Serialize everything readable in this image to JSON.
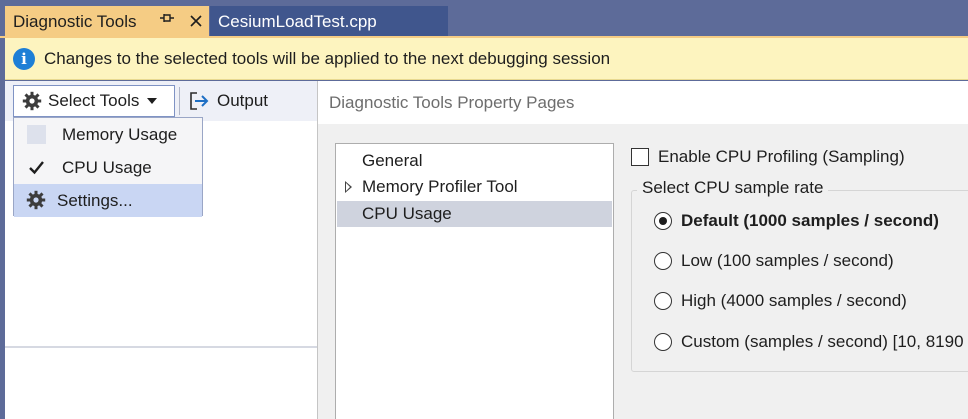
{
  "tabs": {
    "active": {
      "title": "Diagnostic Tools",
      "pin_icon": "pin-icon",
      "close_icon": "close-icon"
    },
    "inactive": {
      "title": "CesiumLoadTest.cpp"
    }
  },
  "infobar": {
    "icon": "info-icon",
    "message": "Changes to the selected tools will be applied to the next debugging session"
  },
  "toolbar": {
    "select_tools_label": "Select Tools",
    "output_label": "Output"
  },
  "dropdown": {
    "items": [
      {
        "label": "Memory Usage",
        "checked": false
      },
      {
        "label": "CPU Usage",
        "checked": true
      },
      {
        "label": "Settings..."
      }
    ]
  },
  "dialog": {
    "title": "Diagnostic Tools Property Pages",
    "tree": [
      {
        "label": "General",
        "expandable": false,
        "selected": false
      },
      {
        "label": "Memory Profiler Tool",
        "expandable": true,
        "selected": false
      },
      {
        "label": "CPU Usage",
        "expandable": false,
        "selected": true
      }
    ],
    "enable_profiling": {
      "label": "Enable CPU Profiling (Sampling)",
      "checked": false
    },
    "sample_rate": {
      "legend": "Select CPU sample rate",
      "options": [
        {
          "label": "Default (1000 samples / second)",
          "selected": true
        },
        {
          "label": "Low (100 samples / second)",
          "selected": false
        },
        {
          "label": "High (4000 samples / second)",
          "selected": false
        },
        {
          "label": "Custom (samples / second) [10, 8190",
          "selected": false
        }
      ]
    }
  },
  "colors": {
    "tab_active": "#f5cc84",
    "tab_inactive": "#40568d",
    "chrome": "#5d6b99",
    "infobar": "#fdf4bf",
    "info_icon": "#1e7fd6",
    "menu_highlight": "#c9d6f3",
    "tree_selected": "#cfd3de"
  }
}
